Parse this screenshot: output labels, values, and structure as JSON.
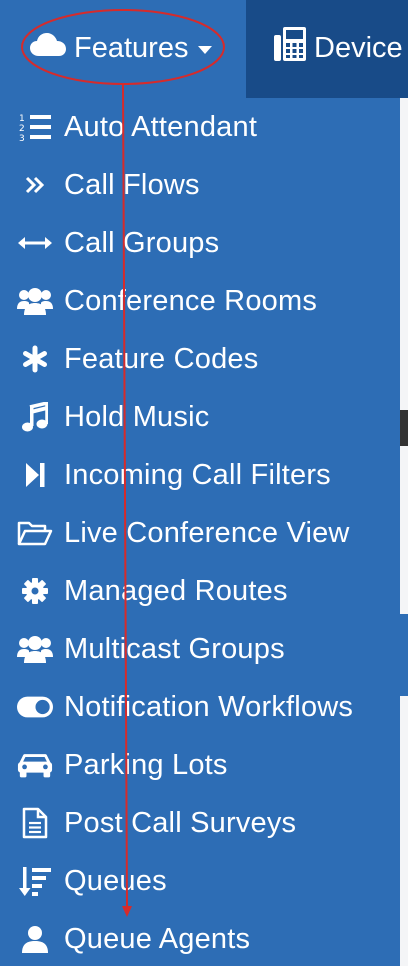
{
  "nav": {
    "features_label": "Features",
    "devices_label": "Device"
  },
  "menu": {
    "items": [
      {
        "label": "Auto Attendant",
        "icon": "numbered-list-icon"
      },
      {
        "label": "Call Flows",
        "icon": "double-chevron-right-icon"
      },
      {
        "label": "Call Groups",
        "icon": "arrows-horizontal-icon"
      },
      {
        "label": "Conference Rooms",
        "icon": "users-icon"
      },
      {
        "label": "Feature Codes",
        "icon": "asterisk-icon"
      },
      {
        "label": "Hold Music",
        "icon": "music-note-icon"
      },
      {
        "label": "Incoming Call Filters",
        "icon": "step-forward-icon"
      },
      {
        "label": "Live Conference View",
        "icon": "folder-open-icon"
      },
      {
        "label": "Managed Routes",
        "icon": "gear-icon"
      },
      {
        "label": "Multicast Groups",
        "icon": "users-icon"
      },
      {
        "label": "Notification Workflows",
        "icon": "toggle-on-icon"
      },
      {
        "label": "Parking Lots",
        "icon": "car-icon"
      },
      {
        "label": "Post Call Surveys",
        "icon": "document-icon"
      },
      {
        "label": "Queues",
        "icon": "sort-amount-down-icon"
      },
      {
        "label": "Queue Agents",
        "icon": "user-icon"
      }
    ]
  },
  "colors": {
    "menu_bg": "#2d6db5",
    "devices_bg": "#184b88",
    "annotation": "#d62b2b"
  }
}
